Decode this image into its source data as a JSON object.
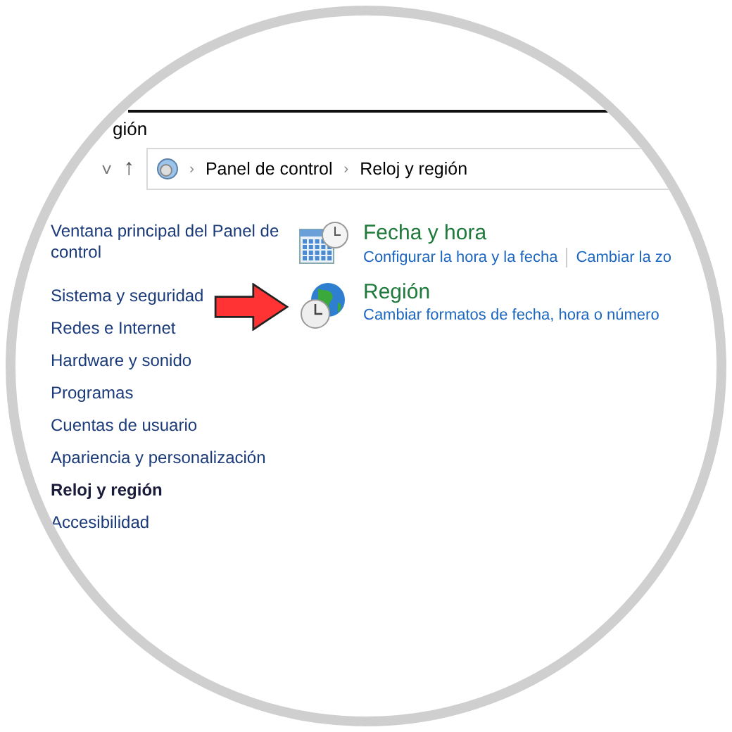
{
  "window": {
    "title": "gión"
  },
  "navigation": {
    "buttons": [
      "˅",
      "↑"
    ]
  },
  "address_bar": {
    "separator": "›",
    "path": [
      "Panel de control",
      "Reloj y región"
    ]
  },
  "sidebar": {
    "items": [
      {
        "label": "Ventana principal del Panel de control",
        "selected": false
      },
      {
        "label": "Sistema y seguridad",
        "selected": false
      },
      {
        "label": "Redes e Internet",
        "selected": false
      },
      {
        "label": "Hardware y sonido",
        "selected": false
      },
      {
        "label": "Programas",
        "selected": false
      },
      {
        "label": "Cuentas de usuario",
        "selected": false
      },
      {
        "label": "Apariencia y personalización",
        "selected": false
      },
      {
        "label": "Reloj y región",
        "selected": true
      },
      {
        "label": "Accesibilidad",
        "selected": false
      }
    ]
  },
  "categories": [
    {
      "kind": "calendar",
      "title": "Fecha y hora",
      "links": [
        "Configurar la hora y la fecha",
        "Cambiar la zo"
      ],
      "highlighted": false
    },
    {
      "kind": "globe",
      "title": "Región",
      "links": [
        "Cambiar formatos de fecha, hora o número"
      ],
      "highlighted": true
    }
  ]
}
